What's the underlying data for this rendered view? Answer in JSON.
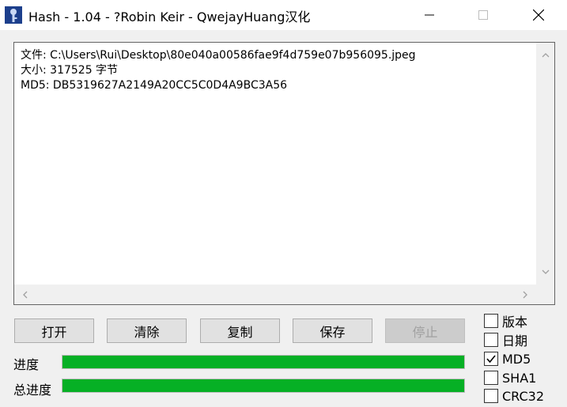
{
  "window": {
    "title": "Hash - 1.04 - ?Robin Keir - QwejayHuang汉化"
  },
  "output": {
    "lines": [
      "文件: C:\\Users\\Rui\\Desktop\\80e040a00586fae9f4d759e07b956095.jpeg",
      "大小: 317525 字节",
      "MD5: DB5319627A2149A20CC5C0D4A9BC3A56"
    ]
  },
  "buttons": {
    "open": "打开",
    "clear": "清除",
    "copy": "复制",
    "save": "保存",
    "stop": "停止"
  },
  "progress": {
    "current_label": "进度",
    "current_value": 1.0,
    "total_label": "总进度",
    "total_value": 1.0,
    "fill_color": "#06b025"
  },
  "options": [
    {
      "label": "版本",
      "checked": false
    },
    {
      "label": "日期",
      "checked": false
    },
    {
      "label": "MD5",
      "checked": true
    },
    {
      "label": "SHA1",
      "checked": false
    },
    {
      "label": "CRC32",
      "checked": false
    }
  ],
  "icons": {
    "app": "hash-app-icon",
    "minimize": "minimize-icon",
    "maximize": "maximize-icon",
    "close": "close-icon"
  }
}
